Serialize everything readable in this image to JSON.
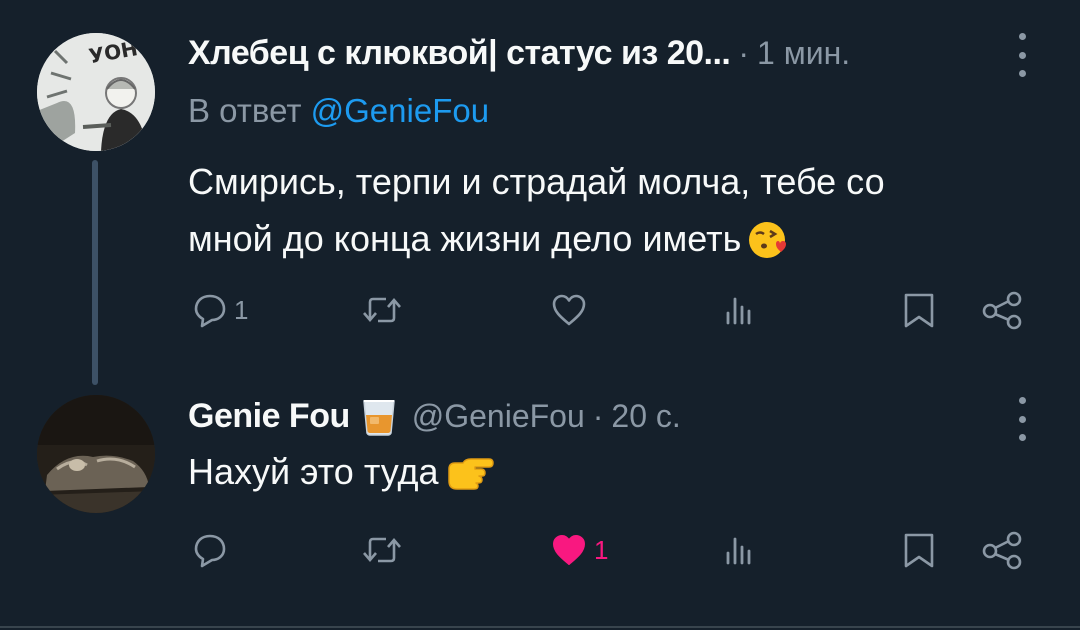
{
  "tweets": [
    {
      "display_name": "Хлебец с клюквой| статус из 20...",
      "separator": "·",
      "time": "1 мин.",
      "reply_prefix": "В ответ",
      "reply_mention": "@GenieFou",
      "text": "Смирись, терпи и страдай молча, тебе со мной до конца жизни дело иметь",
      "text_emoji": "face-blowing-kiss",
      "avatar_text": "УОН",
      "actions": {
        "reply_count": "1",
        "retweet_count": "",
        "like_count": "",
        "views_count": ""
      },
      "liked": false
    },
    {
      "display_name": "Genie Fou",
      "name_badge": "whisky-glass-emoji",
      "handle": "@GenieFou",
      "separator": "·",
      "time": "20 с.",
      "text": "Нахуй это туда",
      "text_emoji": "pointing-right-hand",
      "actions": {
        "reply_count": "",
        "retweet_count": "",
        "like_count": "1",
        "views_count": ""
      },
      "liked": true
    }
  ],
  "colors": {
    "background": "#15202b",
    "text_primary": "#f7f9f9",
    "text_secondary": "#8b98a5",
    "link": "#1d9bf0",
    "like": "#f91880",
    "thread_line": "#3d5166"
  }
}
